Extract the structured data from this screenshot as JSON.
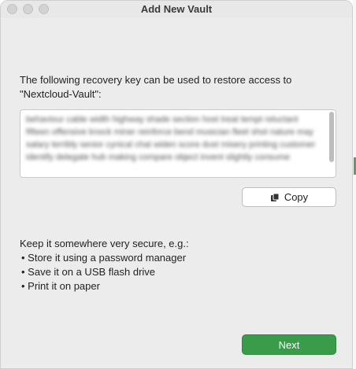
{
  "window": {
    "title": "Add New Vault"
  },
  "intro": {
    "line1": "The following recovery key can be used to restore access to",
    "line2": "\"Nextcloud-Vault\":"
  },
  "recovery_key": {
    "text": "behaviour cable width highway shade section host treat tempt reluctant fifteen offensive knock miner reinforce bend musician fleet shot nature may salary terribly senior cynical chat widen score dust misery printing customer identify delegate hub making compare object invent slightly consume"
  },
  "copy_button": {
    "label": "Copy",
    "icon": "copy-icon"
  },
  "instructions": {
    "heading": "Keep it somewhere very secure, e.g.:",
    "items": [
      "• Store it using a password manager",
      "• Save it on a USB flash drive",
      "• Print it on paper"
    ]
  },
  "next_button": {
    "label": "Next",
    "color": "#3a9c4a"
  }
}
